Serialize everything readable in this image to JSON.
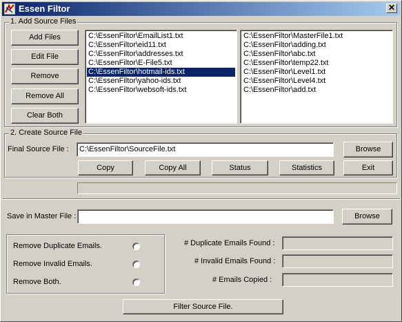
{
  "window": {
    "title": "Essen Filtor",
    "close_glyph": "✕",
    "icon": "app-icon"
  },
  "add_section": {
    "legend": "1. Add Source Files",
    "buttons": {
      "add_files": "Add Files",
      "edit_file": "Edit File",
      "remove": "Remove",
      "remove_all": "Remove All",
      "clear_both": "Clear Both"
    },
    "left_list": [
      "C:\\EssenFiltor\\EmailList1.txt",
      "C:\\EssenFiltor\\eid11.txt",
      "C:\\EssenFiltor\\addresses.txt",
      "C:\\EssenFiltor\\E-File5.txt",
      "C:\\EssenFiltor\\hotmail-ids.txt",
      "C:\\EssenFiltor\\yahoo-ids.txt",
      "C:\\EssenFiltor\\websoft-ids.txt"
    ],
    "left_selected_index": 4,
    "right_list": [
      "C:\\EssenFiltor\\MasterFile1.txt",
      "C:\\EssenFiltor\\adding.txt",
      "C:\\EssenFiltor\\abc.txt",
      "C:\\EssenFiltor\\temp22.txt",
      "C:\\EssenFiltor\\Level1.txt",
      "C:\\EssenFiltor\\Level4.txt",
      "C:\\EssenFiltor\\add.txt"
    ]
  },
  "create_section": {
    "legend": "2. Create Source File",
    "final_label": "Final Source File :",
    "final_value": "C:\\EssenFiltor\\SourceFile.txt",
    "browse": "Browse",
    "buttons": {
      "copy": "Copy",
      "copy_all": "Copy All",
      "status": "Status",
      "statistics": "Statistics",
      "exit": "Exit"
    }
  },
  "master_section": {
    "label": "Save in Master File :",
    "value": "",
    "browse": "Browse"
  },
  "options": {
    "remove_duplicate": "Remove Duplicate Emails.",
    "remove_invalid": "Remove Invalid Emails.",
    "remove_both": "Remove Both."
  },
  "stats": {
    "duplicate_label": "# Duplicate Emails Found :",
    "duplicate_value": "",
    "invalid_label": "# Invalid Emails Found :",
    "invalid_value": "",
    "copied_label": "#  Emails Copied :",
    "copied_value": ""
  },
  "filter_button": "Filter Source File."
}
